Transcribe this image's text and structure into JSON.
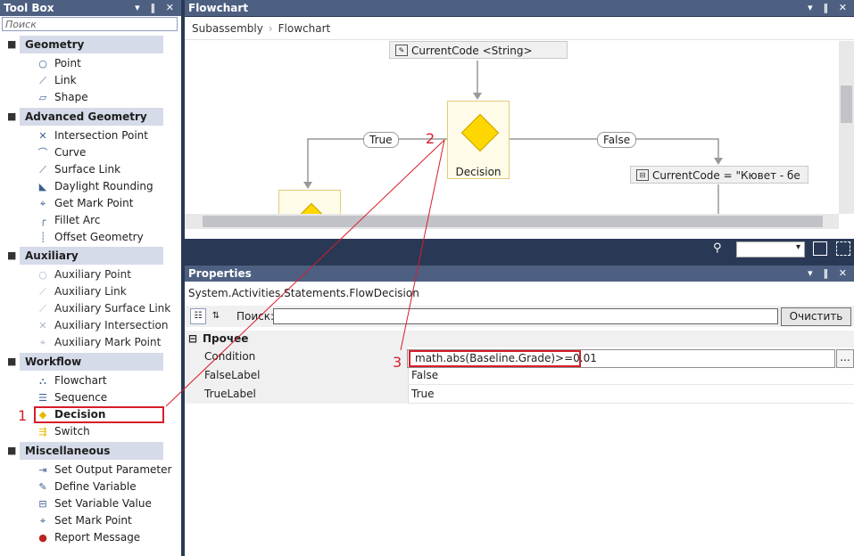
{
  "toolbox": {
    "title": "Tool Box",
    "search_placeholder": "Поиск",
    "categories": [
      {
        "name": "Geometry",
        "items": [
          "Point",
          "Link",
          "Shape"
        ]
      },
      {
        "name": "Advanced Geometry",
        "items": [
          "Intersection Point",
          "Curve",
          "Surface Link",
          "Daylight Rounding",
          "Get Mark Point",
          "Fillet Arc",
          "Offset Geometry"
        ]
      },
      {
        "name": "Auxiliary",
        "items": [
          "Auxiliary Point",
          "Auxiliary Link",
          "Auxiliary Surface Link",
          "Auxiliary Intersection",
          "Auxiliary Mark Point"
        ]
      },
      {
        "name": "Workflow",
        "items": [
          "Flowchart",
          "Sequence",
          "Decision",
          "Switch"
        ]
      },
      {
        "name": "Miscellaneous",
        "items": [
          "Set Output Parameter",
          "Define Variable",
          "Set Variable Value",
          "Set Mark Point",
          "Report Message"
        ]
      }
    ],
    "toggle_symbol": "■"
  },
  "designer": {
    "title": "Flowchart",
    "breadcrumb": [
      "Subassembly",
      "Flowchart"
    ],
    "breadcrumb_sep": "›",
    "top_activity": "CurrentCode <String>",
    "decision_label": "Decision",
    "true_label": "True",
    "false_label": "False",
    "assign_activity": "CurrentCode = \"Кювет - бе"
  },
  "properties": {
    "title": "Properties",
    "type_name": "System.Activities.Statements.FlowDecision",
    "search_label": "Поиск:",
    "search_value": "",
    "clear_button": "Очистить",
    "group": "Прочее",
    "group_toggle": "⊟",
    "rows": [
      {
        "label": "Condition",
        "value": "math.abs(Baseline.Grade)>=0.01"
      },
      {
        "label": "FalseLabel",
        "value": "False"
      },
      {
        "label": "TrueLabel",
        "value": "True"
      }
    ],
    "ellipsis": "..."
  },
  "annotations": {
    "one": "1",
    "two": "2",
    "three": "3"
  },
  "title_buttons": "▾ ‖ ✕",
  "colors": {
    "highlight": "#d61e2a",
    "panel_title": "#4d6082",
    "frame": "#293955",
    "decision": "#ffd700"
  }
}
